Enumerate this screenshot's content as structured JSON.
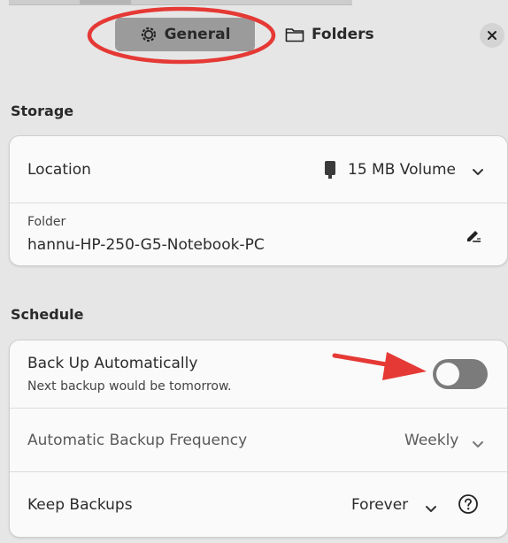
{
  "tabs": {
    "general": "General",
    "folders": "Folders"
  },
  "storage": {
    "title": "Storage",
    "location_label": "Location",
    "location_value": "15 MB Volume",
    "folder_label": "Folder",
    "folder_value": "hannu-HP-250-G5-Notebook-PC"
  },
  "schedule": {
    "title": "Schedule",
    "auto_label": "Back Up Automatically",
    "auto_sub": "Next backup would be tomorrow.",
    "auto_enabled": false,
    "frequency_label": "Automatic Backup Frequency",
    "frequency_value": "Weekly",
    "keep_label": "Keep Backups",
    "keep_value": "Forever"
  },
  "colors": {
    "annotation": "#e53935",
    "tab_active": "#9b9b9b",
    "toggle_off": "#7b7b7b"
  },
  "icons": [
    "gear-icon",
    "folder-icon",
    "close-icon",
    "drive-icon",
    "chevron-down-icon",
    "edit-icon",
    "help-icon"
  ]
}
